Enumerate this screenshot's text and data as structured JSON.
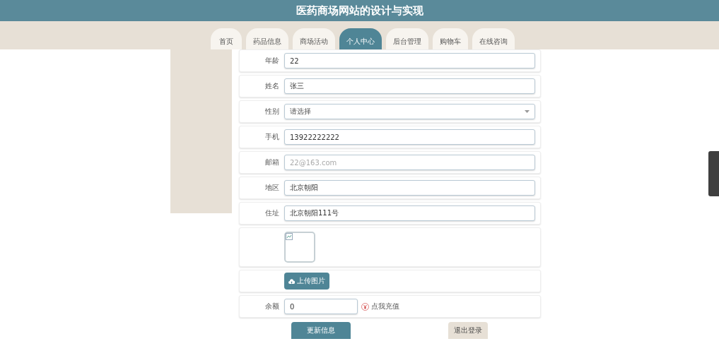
{
  "header": {
    "title": "医药商场网站的设计与实现"
  },
  "nav": [
    {
      "label": "首页",
      "selected": false
    },
    {
      "label": "药品信息",
      "selected": false
    },
    {
      "label": "商场活动",
      "selected": false
    },
    {
      "label": "个人中心",
      "selected": true
    },
    {
      "label": "后台管理",
      "selected": false
    },
    {
      "label": "购物车",
      "selected": false
    },
    {
      "label": "在线咨询",
      "selected": false
    }
  ],
  "form": [
    {
      "kind": "text",
      "label": "年龄",
      "value": "22"
    },
    {
      "kind": "text",
      "label": "姓名",
      "value": "张三"
    },
    {
      "kind": "select",
      "label": "性别",
      "placeholder": "请选择"
    },
    {
      "kind": "text",
      "label": "手机",
      "value": "13922222222"
    },
    {
      "kind": "text",
      "label": "邮箱",
      "placeholder": "22@163.com"
    },
    {
      "kind": "text",
      "label": "地区",
      "value": "北京朝阳"
    },
    {
      "kind": "text",
      "label": "住址",
      "value": "北京朝阳111号"
    },
    {
      "kind": "image"
    },
    {
      "kind": "upload",
      "button": "上传图片"
    },
    {
      "kind": "balance",
      "label": "余额",
      "value": "0",
      "link": "点我充值"
    }
  ],
  "actions": [
    {
      "label": "更新信息",
      "kind": "primary"
    },
    {
      "label": "退出登录",
      "kind": "secondary"
    }
  ]
}
